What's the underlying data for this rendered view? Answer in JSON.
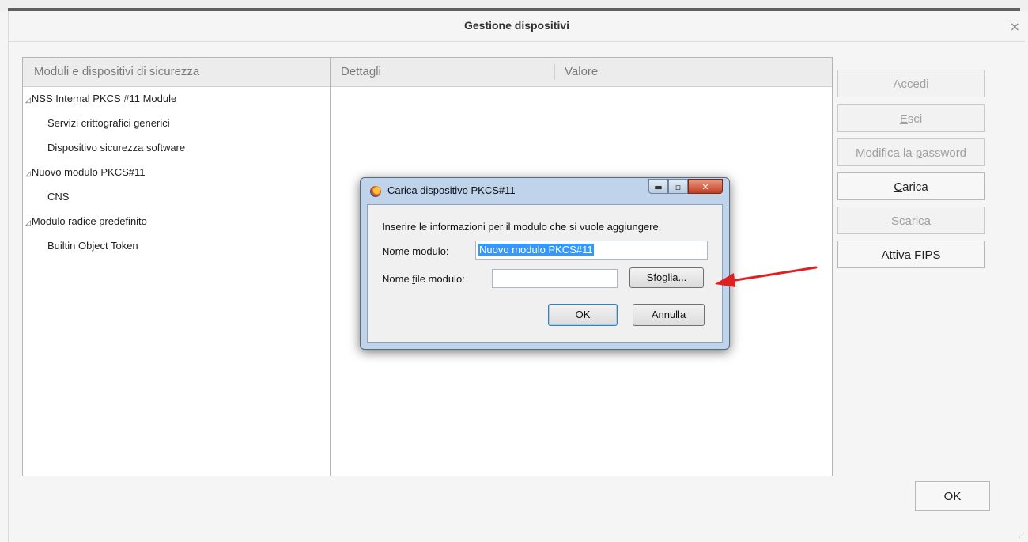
{
  "window": {
    "title": "Gestione dispositivi",
    "close_glyph": "×"
  },
  "columns": {
    "modules": "Moduli e dispositivi di sicurezza",
    "details": "Dettagli",
    "value": "Valore"
  },
  "tree": [
    {
      "label": "NSS Internal PKCS #11 Module",
      "level": 0
    },
    {
      "label": "Servizi crittografici generici",
      "level": 1
    },
    {
      "label": "Dispositivo sicurezza software",
      "level": 1
    },
    {
      "label": "Nuovo modulo PKCS#11",
      "level": 0
    },
    {
      "label": "CNS",
      "level": 1
    },
    {
      "label": "Modulo radice predefinito",
      "level": 0
    },
    {
      "label": "Builtin Object Token",
      "level": 1
    }
  ],
  "side_buttons": {
    "login_pre": "",
    "login_key": "A",
    "login_post": "ccedi",
    "logout_pre": "",
    "logout_key": "E",
    "logout_post": "sci",
    "password_pre": "Modifica la ",
    "password_key": "p",
    "password_post": "assword",
    "load_pre": "",
    "load_key": "C",
    "load_post": "arica",
    "unload_pre": "",
    "unload_key": "S",
    "unload_post": "carica",
    "fips_pre": "Attiva ",
    "fips_key": "F",
    "fips_post": "IPS"
  },
  "ok_button": "OK",
  "modal": {
    "title": "Carica dispositivo PKCS#11",
    "min_glyph": "▬",
    "max_glyph": "▫",
    "close_glyph": "✕",
    "instructions": "Inserire le informazioni per il modulo che si vuole aggiungere.",
    "name_label_key": "N",
    "name_label_rest": "ome modulo:",
    "name_value": "Nuovo modulo PKCS#11",
    "file_label_pre": "Nome ",
    "file_label_key": "f",
    "file_label_post": "ile modulo:",
    "file_value": "",
    "browse_pre": "Sf",
    "browse_key": "o",
    "browse_post": "glia...",
    "ok": "OK",
    "cancel": "Annulla"
  },
  "colors": {
    "arrow": "#e02020",
    "selection": "#3399ff"
  }
}
